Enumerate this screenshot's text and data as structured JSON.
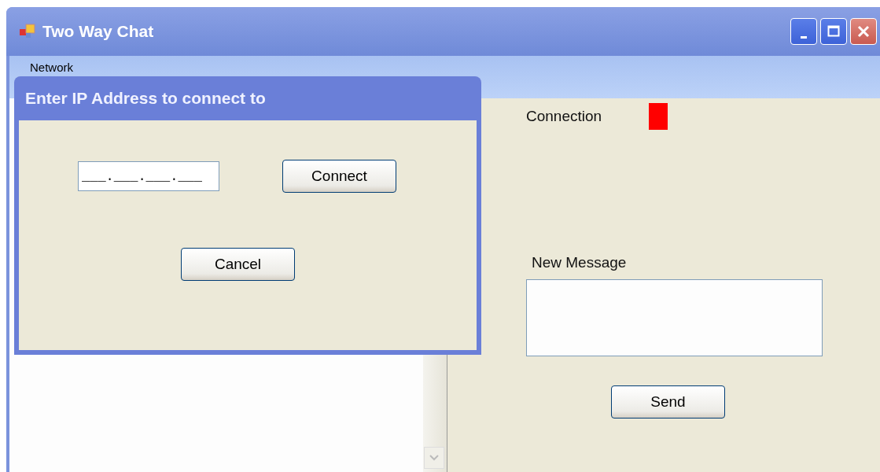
{
  "window": {
    "title": "Two Way Chat"
  },
  "menu": [
    {
      "label": "Network"
    }
  ],
  "connection": {
    "label": "Connection",
    "connected": false
  },
  "new_message": {
    "label": "New Message"
  },
  "send_button": "Send",
  "dialog": {
    "title": "Enter IP Address to connect to",
    "ip_field": {
      "value": "___.___.___.___"
    },
    "connect_button": "Connect",
    "cancel_button": "Cancel"
  }
}
